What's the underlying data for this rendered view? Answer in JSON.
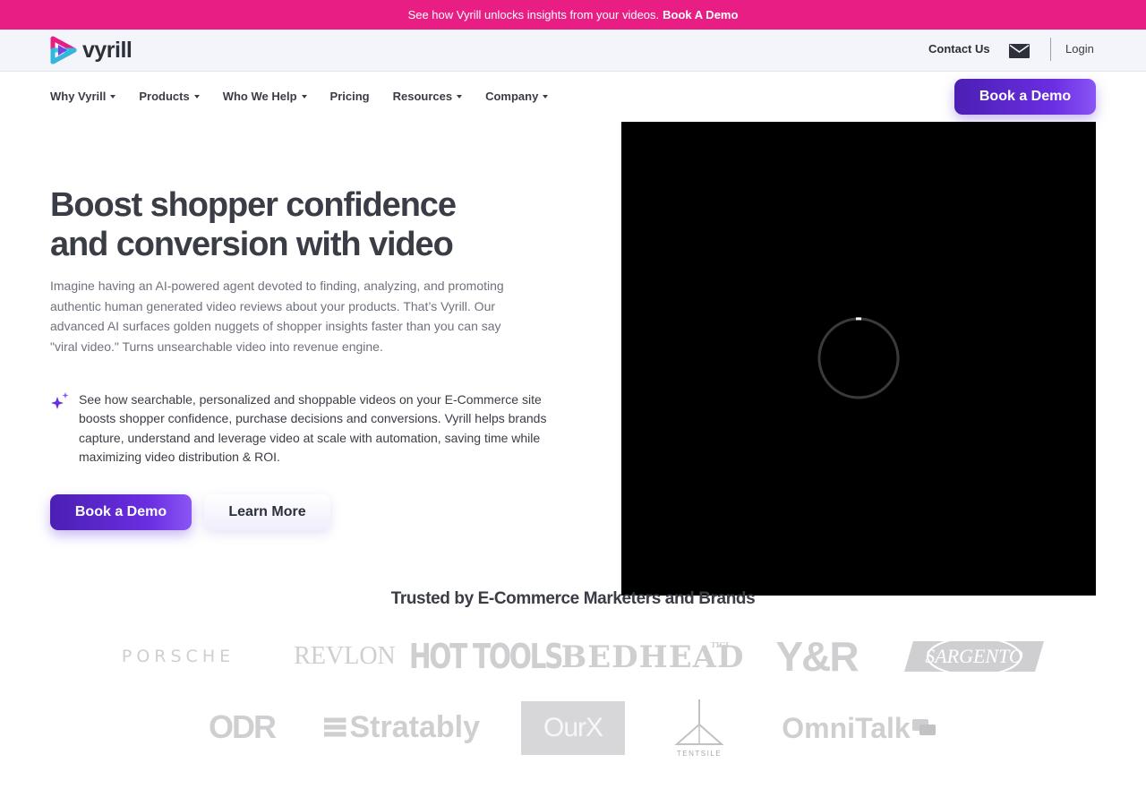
{
  "announcement": {
    "text": "See how Vyrill unlocks insights from your videos.",
    "link": "Book A Demo"
  },
  "brand": {
    "name": "vyrill",
    "colors": {
      "pink": "#e91e84",
      "purple": "#6a2ee2",
      "cyan": "#1ec9e6"
    }
  },
  "topbar": {
    "contact": "Contact Us",
    "login": "Login"
  },
  "nav": {
    "items": [
      "Why Vyrill",
      "Products",
      "Who We Help",
      "Pricing",
      "Resources",
      "Company"
    ],
    "cta": "Book a Demo"
  },
  "hero": {
    "title": "Boost shopper confidence and conversion with video",
    "description": "Imagine having an AI-powered agent devoted to finding, analyzing, and promoting authentic human generated video reviews about your products. That’s Vyrill. Our advanced AI surfaces golden nuggets of shopper insights faster than you can say \"viral video.\" Turns unsearchable video into revenue engine.",
    "feature": "See how searchable, personalized and shoppable videos on your E-Commerce site boosts shopper confidence, purchase decisions and conversions. Vyrill helps brands capture, understand and leverage video at scale with automation, saving time while maximizing video distribution & ROI.",
    "primary_button": "Book a Demo",
    "secondary_button": "Learn More"
  },
  "trusted": {
    "heading": "Trusted by E-Commerce Marketers and Brands",
    "logos": {
      "porsche": "PORSCHE",
      "revlon": "REVLON",
      "hottools": "HOT TOOLS",
      "bedhead": "BEDHEAD",
      "bedhead_mark": "TIGI",
      "yr": "Y&R",
      "sargento": "SARGENTO",
      "odr": "ODR",
      "stratably": "Stratably",
      "ourx": "OurX",
      "tentsile": "TENTSILE",
      "omnitalk": "OmniTalk"
    }
  },
  "icons": [
    "vyrill-logo-icon",
    "mail-icon",
    "caret-down-icon",
    "sparkle-icon",
    "loading-spinner-icon",
    "chat-bubble-icon"
  ]
}
